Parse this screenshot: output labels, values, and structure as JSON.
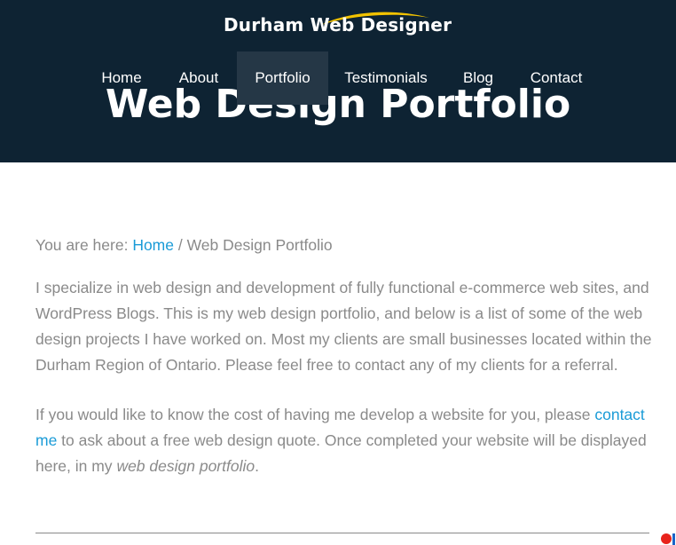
{
  "site": {
    "logo_text": "Durham Web Designer",
    "accent_color": "#f2c200",
    "header_bg": "#0e2333"
  },
  "hero": {
    "title": "Web Design Portfolio"
  },
  "nav": {
    "items": [
      {
        "label": "Home"
      },
      {
        "label": "About"
      },
      {
        "label": "Portfolio",
        "active": true
      },
      {
        "label": "Testimonials"
      },
      {
        "label": "Blog"
      },
      {
        "label": "Contact"
      }
    ]
  },
  "breadcrumb": {
    "prefix": "You are here: ",
    "home": "Home",
    "separator": " / ",
    "current": "Web Design Portfolio"
  },
  "body": {
    "p1": "I specialize in web design and development of fully functional e-commerce web sites, and WordPress Blogs. This is my web design portfolio, and below is a list of some of the web design projects I have worked on. Most my clients are small businesses located within the Durham Region of Ontario. Please feel free to contact any of my clients for a referral.",
    "p2_before": "If you would like to know the cost of having me develop a website for you, please ",
    "p2_link": "contact me",
    "p2_after": " to ask about a free web design quote. Once completed your website will be displayed here, in my ",
    "p2_italic": "web design portfolio",
    "p2_end": "."
  },
  "colors": {
    "link": "#1a9bd7",
    "text": "#8a8a8a",
    "nav_active_bg": "#253746"
  }
}
